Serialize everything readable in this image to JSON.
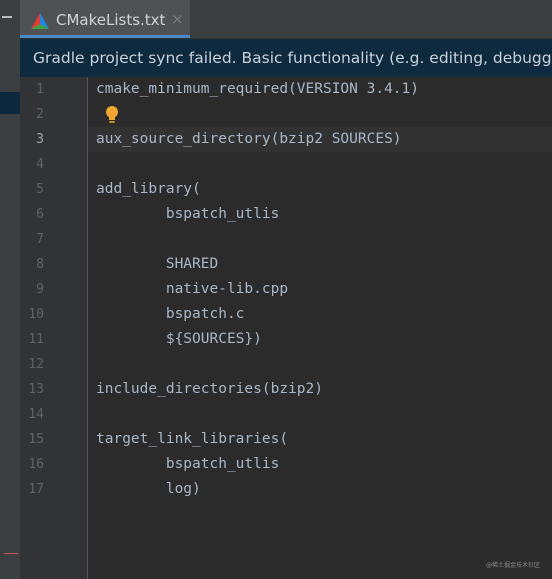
{
  "tab": {
    "label": "CMakeLists.txt",
    "close": "×",
    "icon": "cmake-triangle-icon"
  },
  "banner": {
    "text": "Gradle project sync failed. Basic functionality (e.g. editing, debugging) will not work properly."
  },
  "editor": {
    "current_line": 3,
    "lines": [
      {
        "n": "1",
        "text": "cmake_minimum_required(VERSION 3.4.1)"
      },
      {
        "n": "2",
        "text": ""
      },
      {
        "n": "3",
        "text": "aux_source_directory(bzip2 SOURCES)"
      },
      {
        "n": "4",
        "text": ""
      },
      {
        "n": "5",
        "text": "add_library("
      },
      {
        "n": "6",
        "text": "        bspatch_utlis"
      },
      {
        "n": "7",
        "text": ""
      },
      {
        "n": "8",
        "text": "        SHARED"
      },
      {
        "n": "9",
        "text": "        native-lib.cpp"
      },
      {
        "n": "10",
        "text": "        bspatch.c"
      },
      {
        "n": "11",
        "text": "        ${SOURCES})"
      },
      {
        "n": "12",
        "text": ""
      },
      {
        "n": "13",
        "text": "include_directories(bzip2)"
      },
      {
        "n": "14",
        "text": ""
      },
      {
        "n": "15",
        "text": "target_link_libraries("
      },
      {
        "n": "16",
        "text": "        bspatch_utlis"
      },
      {
        "n": "17",
        "text": "        log)"
      }
    ],
    "intention_icon": "lightbulb-icon"
  },
  "watermark": "@稀土掘金技术社区",
  "colors": {
    "background": "#2b2b2b",
    "gutter": "#313335",
    "banner": "#0e2a3f",
    "tab_active": "#4e5254",
    "tab_underline": "#4a88c7",
    "code": "#a9b7c6"
  }
}
